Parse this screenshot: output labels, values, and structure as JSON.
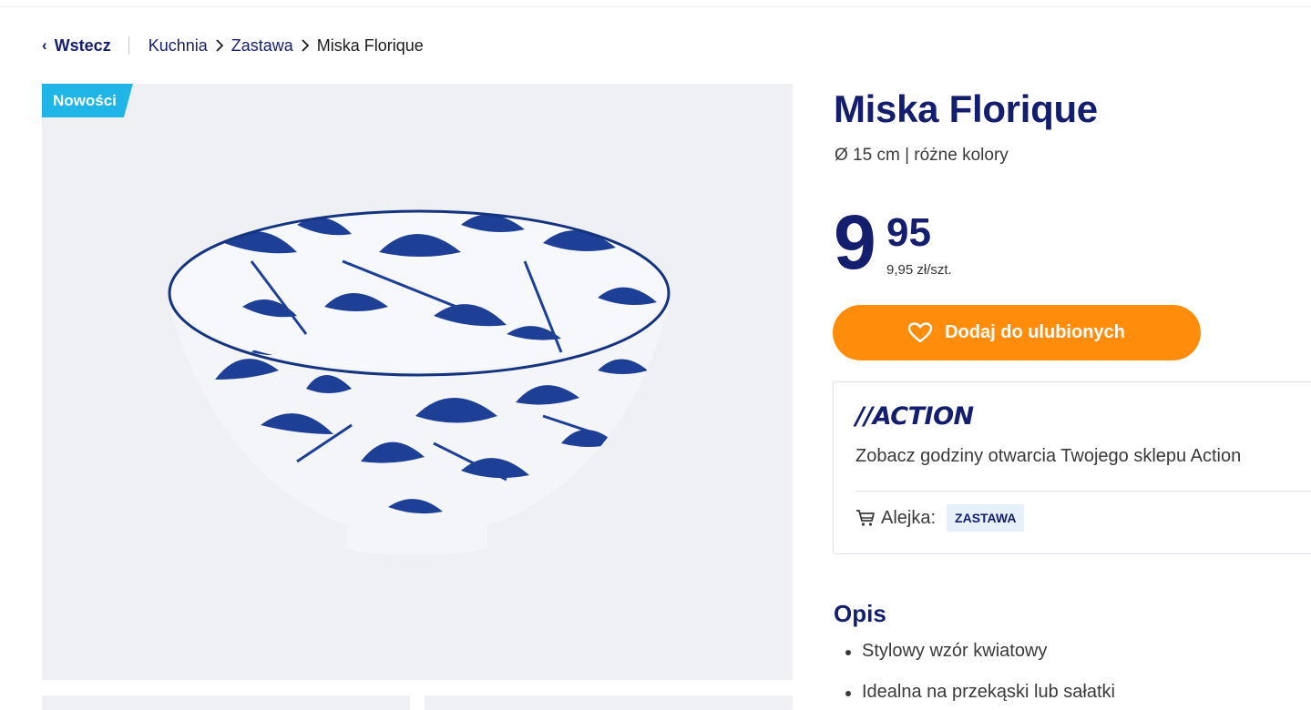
{
  "breadcrumb": {
    "back_label": "Wstecz",
    "items": [
      "Kuchnia",
      "Zastawa"
    ],
    "current": "Miska Florique"
  },
  "gallery": {
    "badge": "Nowości"
  },
  "product": {
    "title": "Miska Florique",
    "subtitle": "Ø 15 cm | różne kolory",
    "price_integer": "9",
    "price_decimal": "95",
    "price_unit": "9,95 zł/szt.",
    "favorite_label": "Dodaj do ulubionych"
  },
  "store": {
    "logo_text": "//ACTION",
    "hours_link": "Zobacz godziny otwarcia Twojego sklepu Action",
    "aisle_label": "Alejka:",
    "aisle_value": "ZASTAWA"
  },
  "description": {
    "title": "Opis",
    "items": [
      "Stylowy wzór kwiatowy",
      "Idealna na przekąski lub sałatki"
    ]
  },
  "colors": {
    "brand_navy": "#141e6e",
    "accent_orange": "#ff8c0a",
    "badge_blue": "#1fb5e6"
  }
}
